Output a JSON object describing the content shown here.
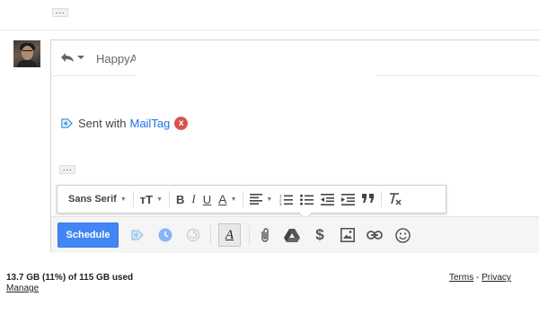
{
  "thread": {
    "top_ellipsis": "···",
    "avatar_alt": ""
  },
  "compose": {
    "recipient": "HappyA",
    "signature": {
      "prefix": "Sent with",
      "link": "MailTag",
      "close": "x"
    },
    "body_ellipsis": "···"
  },
  "format_toolbar": {
    "font_name": "Sans Serif",
    "items": [
      "font-size-icon",
      "bold-icon",
      "italic-icon",
      "underline-icon",
      "text-color-icon",
      "align-icon",
      "numbered-list-icon",
      "bulleted-list-icon",
      "indent-less-icon",
      "indent-more-icon",
      "quote-icon",
      "clear-formatting-icon"
    ],
    "bold": "B",
    "italic": "I",
    "underline": "U",
    "text_color": "A",
    "font_size": "тT"
  },
  "action_bar": {
    "schedule_label": "Schedule",
    "format_toggle": "A",
    "dollar": "$",
    "icons": [
      "mailtag-icon",
      "clock-icon",
      "refresh-icon",
      "attach-icon",
      "drive-icon",
      "dollar-icon",
      "photo-icon",
      "link-icon",
      "emoji-icon"
    ]
  },
  "footer": {
    "storage": "13.7 GB (11%) of 115 GB used",
    "manage": "Manage",
    "terms": "Terms",
    "separator": "-",
    "privacy": "Privacy"
  },
  "colors": {
    "accent": "#4285f4",
    "link": "#1a73e8",
    "close_badge": "#d9534f"
  }
}
